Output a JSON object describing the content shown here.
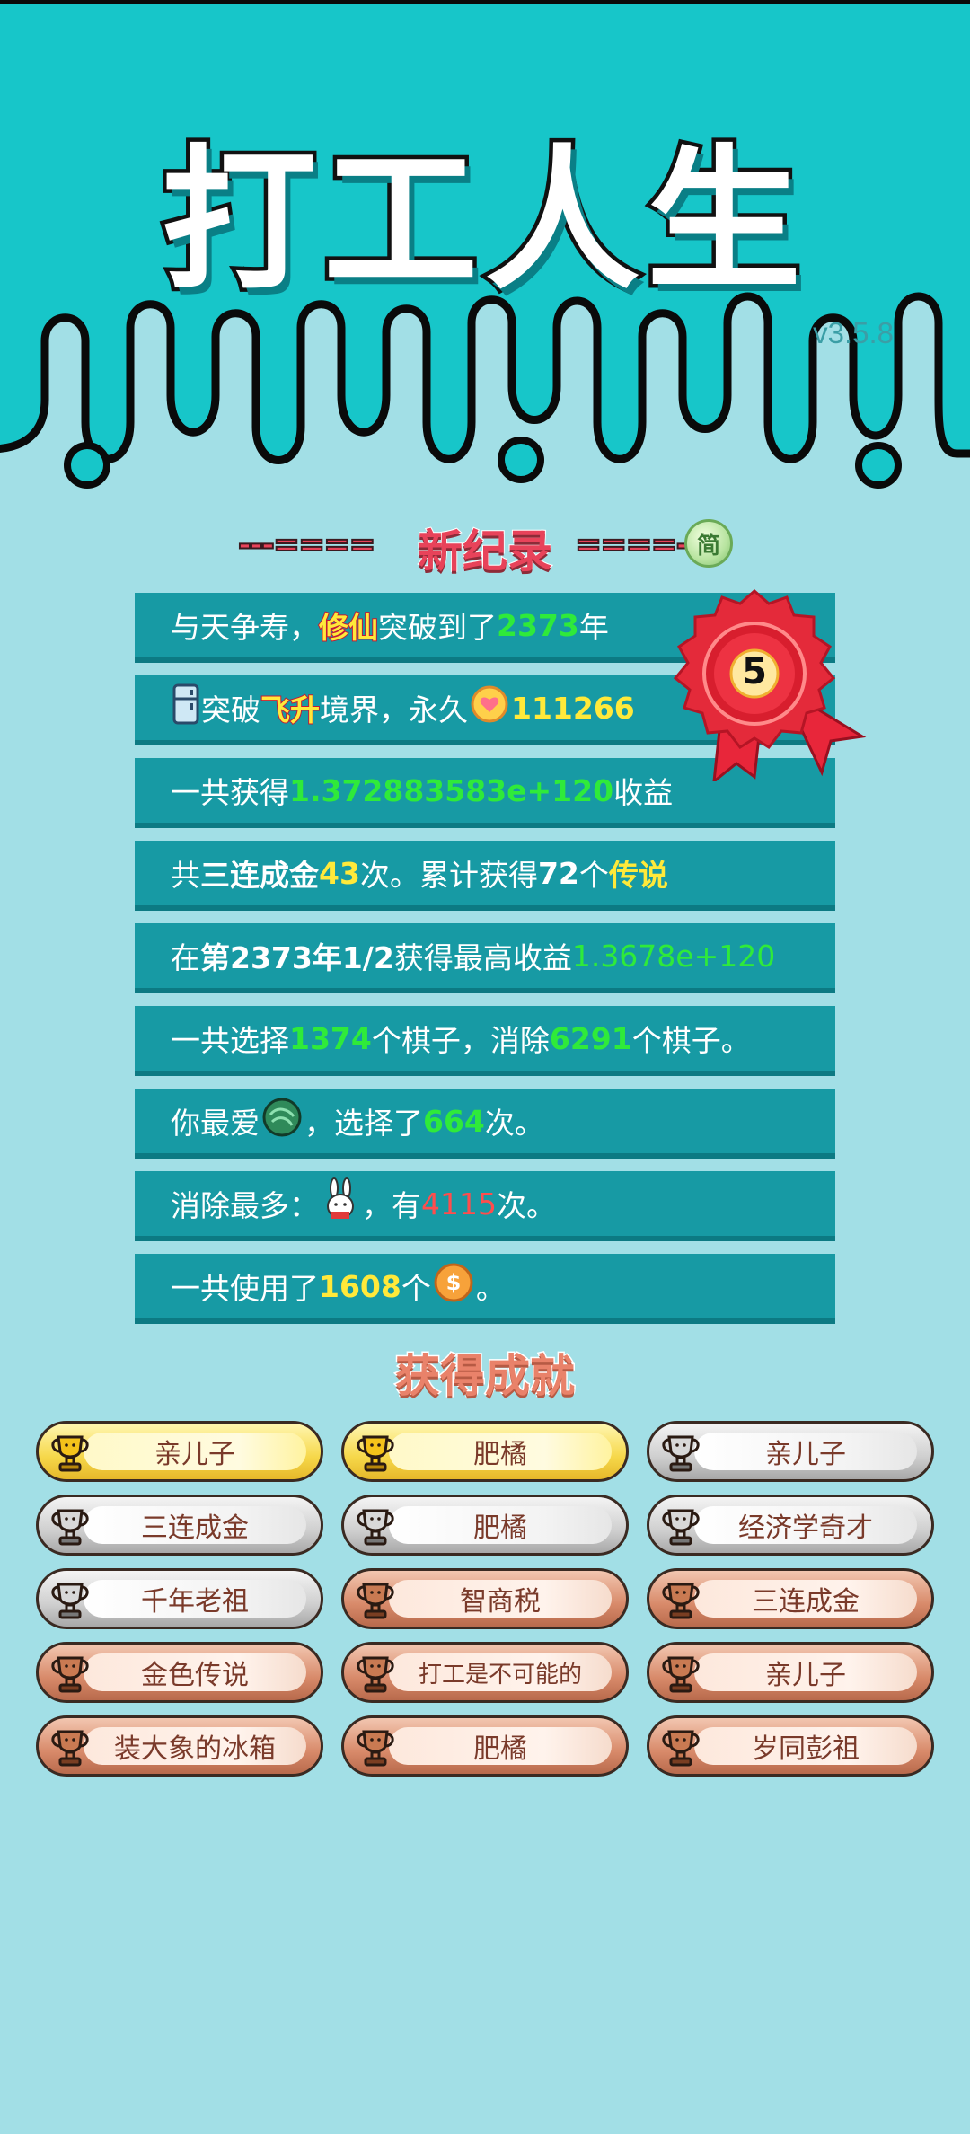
{
  "header": {
    "title": "打工人生",
    "version": "v3.5.8"
  },
  "record": {
    "dash_left": "---====",
    "title": "新纪录",
    "dash_right": "====-",
    "simplified_button": "简",
    "medal_rank": "5"
  },
  "stats": {
    "row1": {
      "a": "与天争寿，",
      "tag": "修仙",
      "b": "突破到了",
      "num": "2373",
      "c": "年"
    },
    "row2": {
      "a": "突破",
      "tag": "飞升",
      "b": "境界，永久",
      "num": "111266"
    },
    "row3": {
      "a": "一共获得",
      "num": "1.372883583e+120",
      "b": "收益"
    },
    "row4": {
      "a": "共",
      "bold1": "三连成金",
      "num1": "43",
      "b": "次。累计获得",
      "num2": "72",
      "c": "个",
      "tag": "传说"
    },
    "row5": {
      "a": "在 ",
      "bold": "第2373年1/2",
      "b": " 获得最高收益",
      "num": "1.3678e+120"
    },
    "row6": {
      "a": "一共选择",
      "num1": "1374",
      "b": "个棋子，消除",
      "num2": "6291",
      "c": "个棋子。"
    },
    "row7": {
      "a": "你最爱",
      "b": "，选择了",
      "num": "664",
      "c": "次。"
    },
    "row8": {
      "a": "消除最多：",
      "b": "，有",
      "num": "4115",
      "c": "次。"
    },
    "row9": {
      "a": "一共使用了",
      "num": "1608",
      "b": "个",
      "c": "。"
    }
  },
  "achievements": {
    "title": "获得成就",
    "items": [
      {
        "label": "亲儿子",
        "tier": "gold"
      },
      {
        "label": "肥橘",
        "tier": "gold"
      },
      {
        "label": "亲儿子",
        "tier": "silver"
      },
      {
        "label": "三连成金",
        "tier": "silver"
      },
      {
        "label": "肥橘",
        "tier": "silver"
      },
      {
        "label": "经济学奇才",
        "tier": "silver"
      },
      {
        "label": "千年老祖",
        "tier": "silver"
      },
      {
        "label": "智商税",
        "tier": "bronze"
      },
      {
        "label": "三连成金",
        "tier": "bronze"
      },
      {
        "label": "金色传说",
        "tier": "bronze"
      },
      {
        "label": "打工是不可能的",
        "tier": "bronze"
      },
      {
        "label": "亲儿子",
        "tier": "bronze"
      },
      {
        "label": "装大象的冰箱",
        "tier": "bronze"
      },
      {
        "label": "肥橘",
        "tier": "bronze"
      },
      {
        "label": "岁同彭祖",
        "tier": "bronze"
      }
    ]
  },
  "colors": {
    "header_bg": "#17c6c9",
    "page_bg": "#a2dfe6",
    "row_bg": "#179aa4",
    "green_value": "#2fea3a",
    "yellow_value": "#ffe93a",
    "red_value": "#ff4d4d",
    "record_red": "#e8435a"
  },
  "icons": {
    "fridge": "fridge-icon",
    "heart_coin": "heart-coin-icon",
    "green_orb": "green-orb-icon",
    "rabbit": "rabbit-icon",
    "dollar_coin": "dollar-coin-icon",
    "trophy": "trophy-icon",
    "medal": "medal-ribbon-icon"
  }
}
